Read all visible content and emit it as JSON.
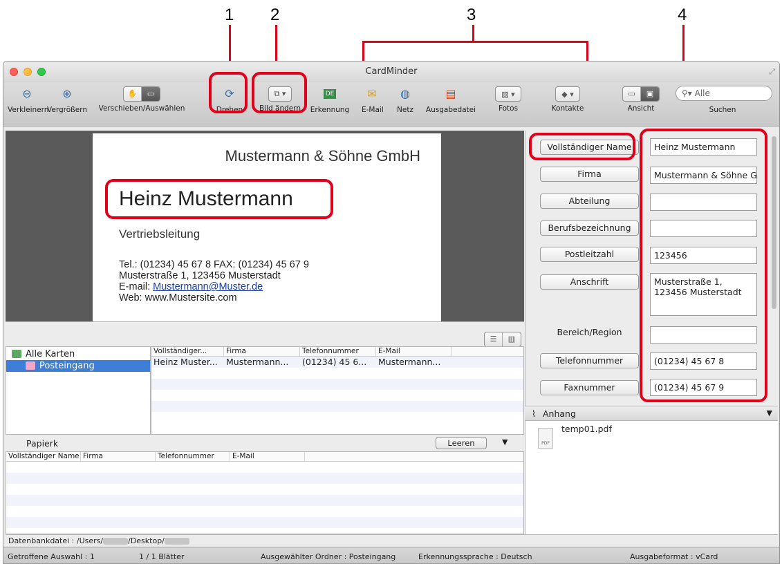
{
  "callouts": [
    "1",
    "2",
    "3",
    "4"
  ],
  "window": {
    "title": "CardMinder"
  },
  "toolbar": {
    "items": [
      {
        "label": "Verkleinern",
        "icon": "zoom-out-icon"
      },
      {
        "label": "Vergrößern",
        "icon": "zoom-in-icon"
      },
      {
        "label": "Verschieben/Auswählen",
        "icon": "hand-select-icon"
      },
      {
        "label": "Drehen",
        "icon": "rotate-icon"
      },
      {
        "label": "Bild ändern",
        "icon": "image-change-icon"
      },
      {
        "label": "Erkennung",
        "icon": "recognition-icon",
        "badge": "DE"
      },
      {
        "label": "E-Mail",
        "icon": "mail-icon"
      },
      {
        "label": "Netz",
        "icon": "globe-icon"
      },
      {
        "label": "Ausgabedatei",
        "icon": "output-file-icon"
      },
      {
        "label": "Fotos",
        "icon": "photos-icon"
      },
      {
        "label": "Kontakte",
        "icon": "contacts-icon"
      },
      {
        "label": "Ansicht",
        "icon": "view-toggle-icon"
      },
      {
        "label": "Suchen",
        "icon": "search-icon"
      }
    ],
    "search_placeholder": "Alle"
  },
  "card": {
    "company": "Mustermann & Söhne GmbH",
    "name": "Heinz Mustermann",
    "department": "Vertriebsleitung",
    "phone_line": "Tel.: (01234) 45 67 8 FAX: (01234) 45 67 9",
    "address_line": "Musterstraße 1, 123456 Musterstadt",
    "email_prefix": "E-mail: ",
    "email": "Mustermann@Muster.de",
    "web_line": "Web: www.Mustersite.com"
  },
  "tree": {
    "items": [
      {
        "label": "Alle Karten",
        "selected": false
      },
      {
        "label": "Posteingang",
        "selected": true
      }
    ]
  },
  "card_list": {
    "columns": [
      "Vollständiger...",
      "Firma",
      "Telefonnummer",
      "E-Mail"
    ],
    "rows": [
      [
        "Heinz Muster...",
        "Mustermann...",
        "(01234) 45 6...",
        "Mustermann..."
      ]
    ]
  },
  "papierkorb": {
    "title": "Papierk",
    "clear_label": "Leeren",
    "columns": [
      "Vollständiger Name",
      "Firma",
      "Telefonnummer",
      "E-Mail"
    ]
  },
  "fields": [
    {
      "label": "Vollständiger Name",
      "value": "Heinz Mustermann",
      "button": true
    },
    {
      "label": "Firma",
      "value": "Mustermann & Söhne G",
      "button": true
    },
    {
      "label": "Abteilung",
      "value": "",
      "button": true
    },
    {
      "label": "Berufsbezeichnung",
      "value": "",
      "button": true
    },
    {
      "label": "Postleitzahl",
      "value": "123456",
      "button": true
    },
    {
      "label": "Anschrift",
      "value": "Musterstraße 1,\n123456 Musterstadt",
      "button": true
    },
    {
      "label": "Bereich/Region",
      "value": "",
      "button": false
    },
    {
      "label": "Telefonnummer",
      "value": "(01234) 45 67 8",
      "button": true
    },
    {
      "label": "Faxnummer",
      "value": "(01234) 45 67 9",
      "button": true
    }
  ],
  "attachments": {
    "title": "Anhang",
    "file": "temp01.pdf",
    "file_badge": "PDF"
  },
  "db": {
    "prefix": "Datenbankdatei : /Users/",
    "middle": "/Desktop/"
  },
  "status": {
    "selection": "Getroffene Auswahl : 1",
    "sheets": "1 / 1 Blätter",
    "folder": "Ausgewählter Ordner : Posteingang",
    "language": "Erkennungssprache : Deutsch",
    "format": "Ausgabeformat : vCard"
  },
  "colors": {
    "callout": "#e0001a",
    "selection": "#3d7fd8"
  }
}
